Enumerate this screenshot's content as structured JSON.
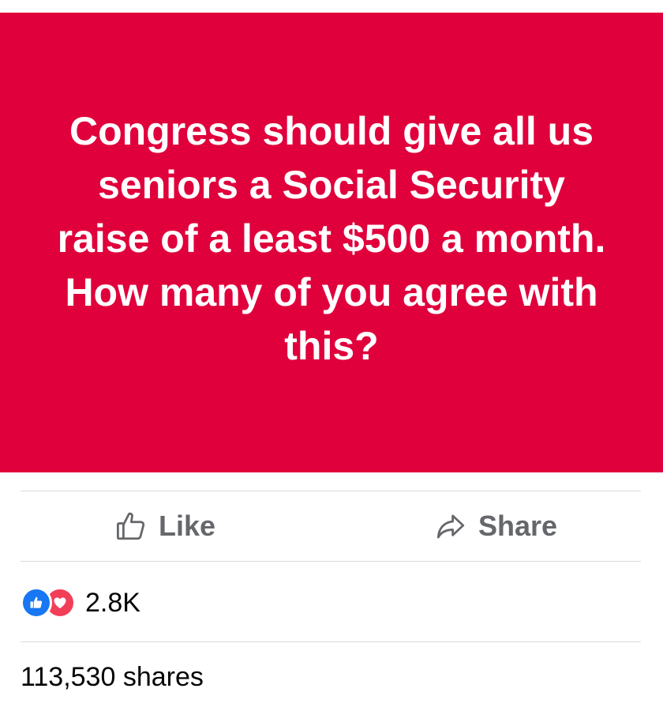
{
  "post": {
    "banner_text": "Congress should give all us seniors a Social Security raise of a least $500 a month. How many of you agree with this?",
    "banner_color": "#e0003c"
  },
  "actions": {
    "like_label": "Like",
    "share_label": "Share"
  },
  "reactions": {
    "icons": [
      "like-icon",
      "love-icon"
    ],
    "count": "2.8K"
  },
  "shares": {
    "label": "113,530 shares"
  },
  "colors": {
    "like_blue": "#1877f2",
    "love_red": "#f33e58",
    "action_gray": "#65676b"
  }
}
